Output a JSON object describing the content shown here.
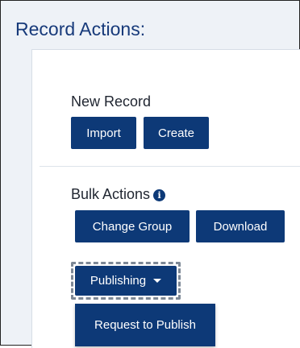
{
  "panel": {
    "title": "Record Actions:"
  },
  "new_record": {
    "label": "New Record",
    "import_label": "Import",
    "create_label": "Create"
  },
  "bulk_actions": {
    "label": "Bulk Actions",
    "info_icon": "info-circle-icon",
    "change_group_label": "Change Group",
    "download_label": "Download"
  },
  "publishing": {
    "label": "Publishing",
    "caret_icon": "caret-down-icon",
    "menu_items": [
      {
        "label": "Request to Publish"
      }
    ]
  },
  "colors": {
    "accent": "#0d3977",
    "title": "#173a7a",
    "background": "#eef2f7"
  }
}
